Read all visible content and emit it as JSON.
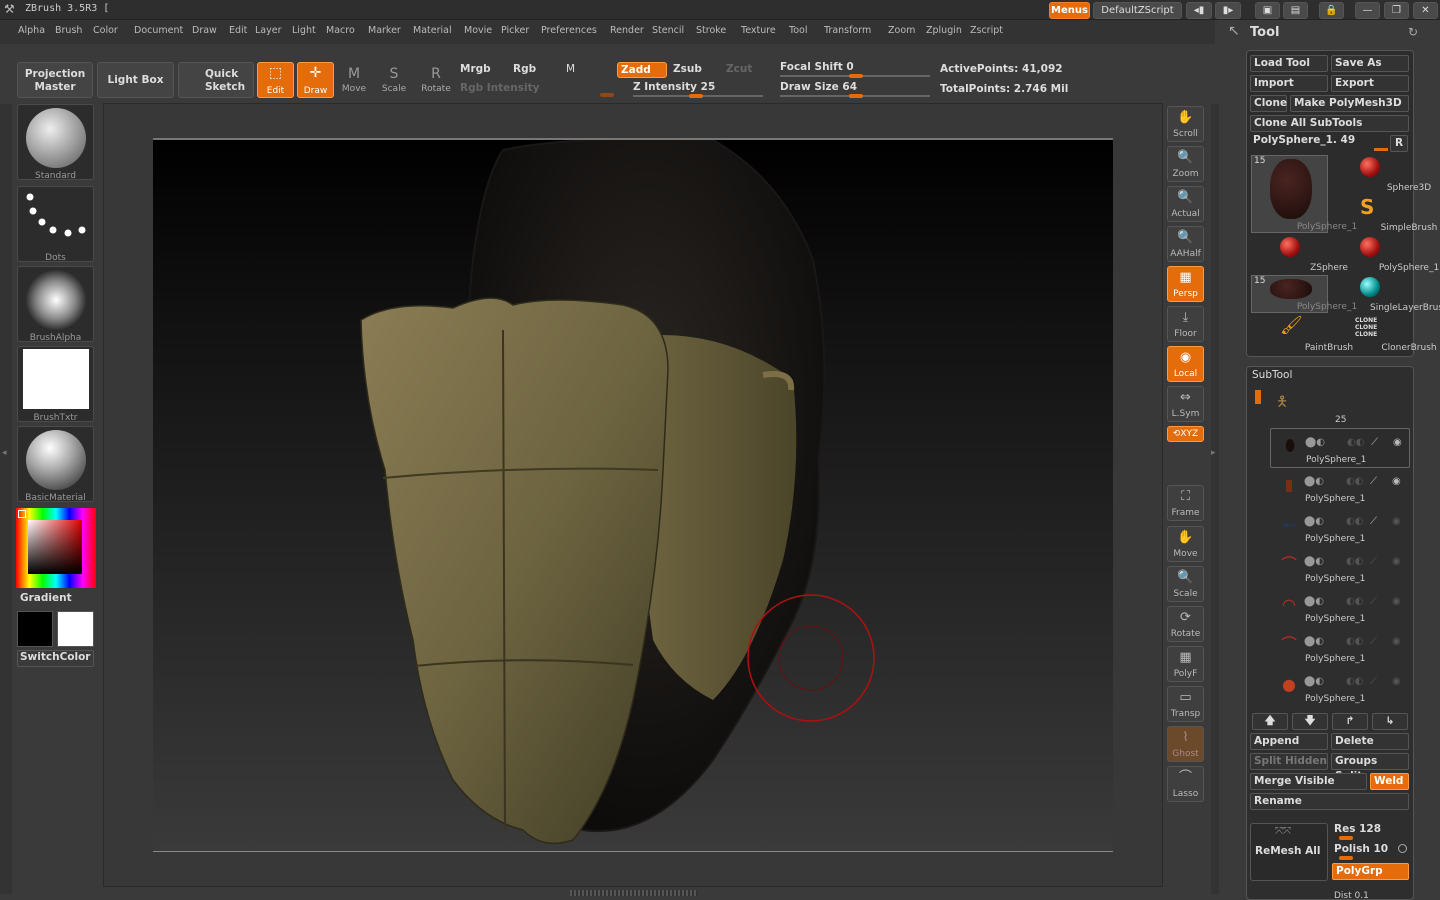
{
  "title": "ZBrush 3.5R3 [",
  "titlebar": {
    "menus_label": "Menus",
    "script_label": "DefaultZScript"
  },
  "menubar": [
    "Alpha",
    "Brush",
    "Color",
    "Document",
    "Draw",
    "Edit",
    "Layer",
    "Light",
    "Macro",
    "Marker",
    "Material",
    "Movie",
    "Picker",
    "Preferences",
    "Render",
    "Stencil",
    "Stroke",
    "Texture",
    "Tool",
    "Transform",
    "Zoom",
    "Zplugin",
    "Zscript"
  ],
  "toolbar": {
    "projection_master": "Projection Master",
    "light_box": "Light Box",
    "quick_sketch": "Quick Sketch",
    "edit": "Edit",
    "draw": "Draw",
    "move": "Move",
    "scale": "Scale",
    "rotate": "Rotate",
    "mrgb": "Mrgb",
    "rgb": "Rgb",
    "m": "M",
    "rgb_intensity": "Rgb Intensity",
    "zadd": "Zadd",
    "zsub": "Zsub",
    "zcut": "Zcut",
    "z_intensity": "Z Intensity 25",
    "focal_shift": "Focal Shift 0",
    "draw_size": "Draw Size 64",
    "active_points": "ActivePoints: 41,092",
    "total_points": "TotalPoints: 2.746 Mil"
  },
  "leftshelf": {
    "standard": "Standard",
    "dots": "Dots",
    "brush_alpha": "BrushAlpha",
    "brush_txtr": "BrushTxtr",
    "basic_material": "BasicMaterial",
    "gradient": "Gradient",
    "switch_color": "SwitchColor"
  },
  "rightshelf": [
    "Scroll",
    "Zoom",
    "Actual",
    "AAHalf",
    "Persp",
    "Floor",
    "Local",
    "L.Sym",
    "XYZ",
    "Frame",
    "Move",
    "Scale",
    "Rotate",
    "PolyF",
    "Transp",
    "Ghost",
    "Lasso"
  ],
  "tool_panel": {
    "title": "Tool",
    "load_tool": "Load Tool",
    "save_as": "Save As",
    "import": "Import",
    "export": "Export",
    "clone": "Clone",
    "make_polymesh": "Make PolyMesh3D",
    "clone_all": "Clone  All  SubTools",
    "current_tool": "PolySphere_1. 49",
    "r": "R",
    "tools": [
      "PolySphere_1",
      "Sphere3D",
      "SimpleBrush",
      "ZSphere",
      "PolySphere_1",
      "PolySphere_1",
      "SingleLayerBrush",
      "PaintBrush",
      "ClonerBrush"
    ],
    "tool_counts": [
      "15",
      "15"
    ]
  },
  "subtool": {
    "title": "SubTool",
    "count_label": "25",
    "items": [
      "PolySphere_1",
      "PolySphere_1",
      "PolySphere_1",
      "PolySphere_1",
      "PolySphere_1",
      "PolySphere_1",
      "PolySphere_1"
    ],
    "append": "Append",
    "delete": "Delete",
    "split_hidden": "Split  Hidden",
    "groups_split": "Groups  Split",
    "merge_visible": "Merge  Visible",
    "weld": "Weld",
    "rename": "Rename",
    "remesh_all": "ReMesh  All",
    "res": "Res 128",
    "polish": "Polish 10",
    "polygrp": "PolyGrp",
    "dist": "Dist 0.1"
  },
  "colors": {
    "accent": "#e46c0a",
    "panel": "#3a3a3a"
  }
}
